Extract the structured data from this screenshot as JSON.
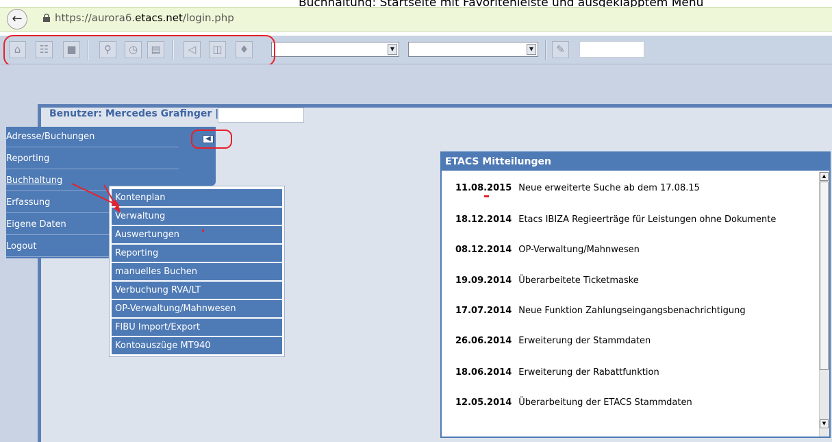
{
  "caption": "Buchhaltung: Startseite mit Favoritenleiste und ausgeklapptem Menü",
  "browser": {
    "url_prefix": "https://aurora6.",
    "url_domain": "etacs.net",
    "url_path": "/login.php"
  },
  "toolbar": {
    "icons": [
      "home-icon",
      "contact-card-icon",
      "box-icon",
      "magnifier-icon",
      "clock-icon",
      "id-card-icon",
      "folder-icon",
      "copy-windows-icon",
      "print-icon"
    ],
    "select1_value": "",
    "select2_value": "",
    "edit_icon": "edit-note-icon",
    "input_value": ""
  },
  "user": {
    "label": "Benutzer: Mercedes Grafinger |",
    "input_value": ""
  },
  "nav": {
    "items": [
      {
        "label": "Adresse/Buchungen"
      },
      {
        "label": "Reporting"
      },
      {
        "label": "Buchhaltung"
      },
      {
        "label": "Erfassung"
      },
      {
        "label": "Eigene Daten"
      },
      {
        "label": "Logout"
      }
    ]
  },
  "submenu": {
    "items": [
      {
        "label": "Kontenplan"
      },
      {
        "label": "Verwaltung"
      },
      {
        "label": "Auswertungen"
      },
      {
        "label": "Reporting"
      },
      {
        "label": "manuelles Buchen"
      },
      {
        "label": "Verbuchung RVA/LT"
      },
      {
        "label": "OP-Verwaltung/Mahnwesen"
      },
      {
        "label": "FIBU Import/Export"
      },
      {
        "label": "Kontoauszüge MT940"
      }
    ]
  },
  "news": {
    "title": "ETACS Mitteilungen",
    "items": [
      {
        "date": "11.08.2015",
        "text": "Neue erweiterte Suche ab dem 17.08.15"
      },
      {
        "date": "18.12.2014",
        "text": "Etacs IBIZA Regieerträge für Leistungen ohne Dokumente"
      },
      {
        "date": "08.12.2014",
        "text": "OP-Verwaltung/Mahnwesen"
      },
      {
        "date": "19.09.2014",
        "text": "Überarbeitete Ticketmaske"
      },
      {
        "date": "17.07.2014",
        "text": "Neue Funktion Zahlungseingangsbenachrichtigung"
      },
      {
        "date": "26.06.2014",
        "text": "Erweiterung der Stammdaten"
      },
      {
        "date": "18.06.2014",
        "text": "Erweiterung der Rabattfunktion"
      },
      {
        "date": "12.05.2014",
        "text": "Überarbeitung der ETACS Stammdaten"
      }
    ]
  },
  "colors": {
    "accent": "#4e7ab5",
    "annotation_red": "#e8202a",
    "url_bar": "#eef8d8"
  }
}
